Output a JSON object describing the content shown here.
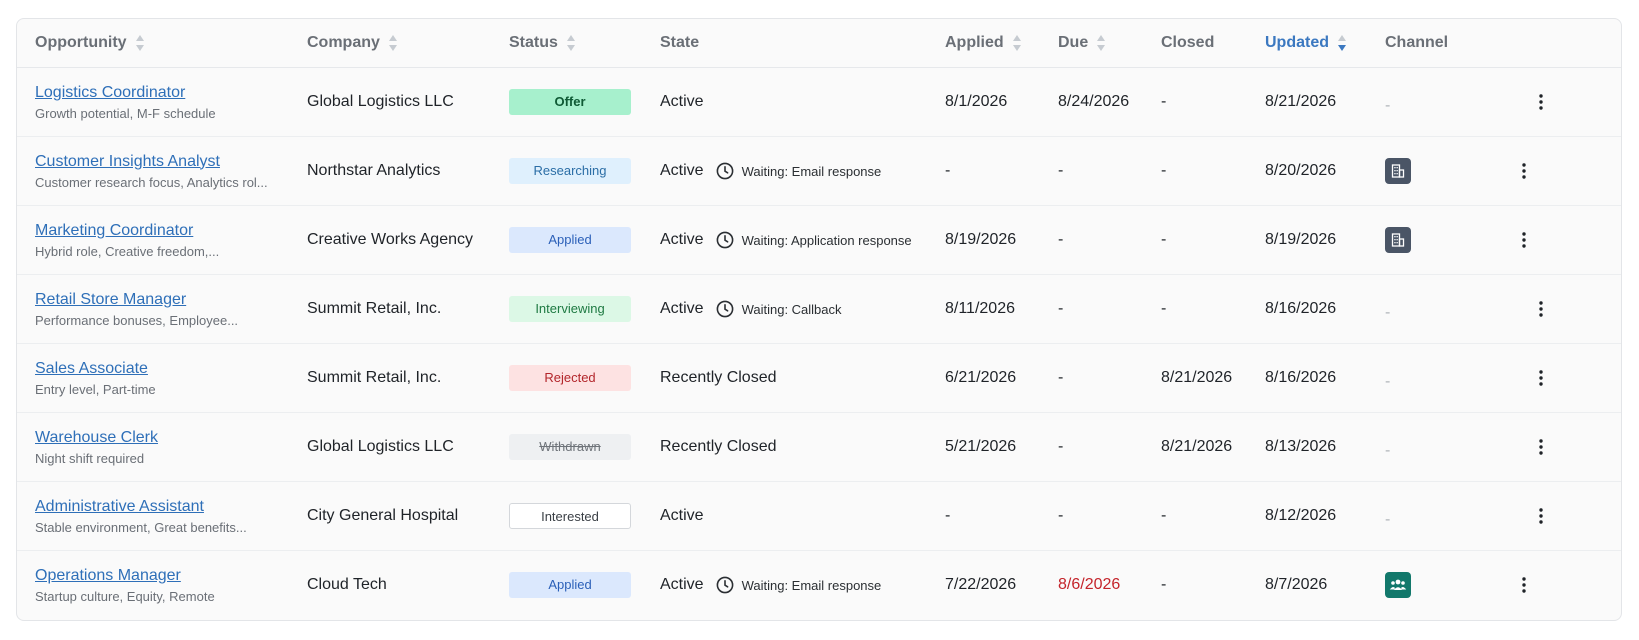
{
  "columns": {
    "opportunity": "Opportunity",
    "company": "Company",
    "status": "Status",
    "state": "State",
    "applied": "Applied",
    "due": "Due",
    "closed": "Closed",
    "updated": "Updated",
    "channel": "Channel"
  },
  "colors": {
    "link": "#2e6fb8",
    "active_sort": "#3b78c0",
    "overdue": "#c4242b"
  },
  "rows": [
    {
      "title": "Logistics Coordinator",
      "desc": "Growth potential, M-F schedule",
      "company": "Global Logistics LLC",
      "status": "Offer",
      "status_key": "offer",
      "state": "Active",
      "waiting": "",
      "applied": "8/1/2026",
      "due": "8/24/2026",
      "closed": "-",
      "updated": "8/21/2026",
      "channel": "-",
      "channel_icon": ""
    },
    {
      "title": "Customer Insights Analyst",
      "desc": "Customer research focus, Analytics rol...",
      "company": "Northstar Analytics",
      "status": "Researching",
      "status_key": "researching",
      "state": "Active",
      "waiting": "Waiting: Email response",
      "applied": "-",
      "due": "-",
      "closed": "-",
      "updated": "8/20/2026",
      "channel": "",
      "channel_icon": "building-icon"
    },
    {
      "title": "Marketing Coordinator",
      "desc": "Hybrid role, Creative freedom,...",
      "company": "Creative Works Agency",
      "status": "Applied",
      "status_key": "applied",
      "state": "Active",
      "waiting": "Waiting: Application response",
      "applied": "8/19/2026",
      "due": "-",
      "closed": "-",
      "updated": "8/19/2026",
      "channel": "",
      "channel_icon": "building-icon"
    },
    {
      "title": "Retail Store Manager",
      "desc": "Performance bonuses, Employee...",
      "company": "Summit Retail, Inc.",
      "status": "Interviewing",
      "status_key": "interviewing",
      "state": "Active",
      "waiting": "Waiting: Callback",
      "applied": "8/11/2026",
      "due": "-",
      "closed": "-",
      "updated": "8/16/2026",
      "channel": "-",
      "channel_icon": ""
    },
    {
      "title": "Sales Associate",
      "desc": "Entry level, Part-time",
      "company": "Summit Retail, Inc.",
      "status": "Rejected",
      "status_key": "rejected",
      "state": "Recently Closed",
      "waiting": "",
      "applied": "6/21/2026",
      "due": "-",
      "closed": "8/21/2026",
      "updated": "8/16/2026",
      "channel": "-",
      "channel_icon": ""
    },
    {
      "title": "Warehouse Clerk",
      "desc": "Night shift required",
      "company": "Global Logistics LLC",
      "status": "Withdrawn",
      "status_key": "withdrawn",
      "state": "Recently Closed",
      "waiting": "",
      "applied": "5/21/2026",
      "due": "-",
      "closed": "8/21/2026",
      "updated": "8/13/2026",
      "channel": "-",
      "channel_icon": ""
    },
    {
      "title": "Administrative Assistant",
      "desc": "Stable environment, Great benefits...",
      "company": "City General Hospital",
      "status": "Interested",
      "status_key": "interested",
      "state": "Active",
      "waiting": "",
      "applied": "-",
      "due": "-",
      "closed": "-",
      "updated": "8/12/2026",
      "channel": "-",
      "channel_icon": ""
    },
    {
      "title": "Operations Manager",
      "desc": "Startup culture, Equity, Remote",
      "company": "Cloud Tech",
      "status": "Applied",
      "status_key": "applied",
      "state": "Active",
      "waiting": "Waiting: Email response",
      "applied": "7/22/2026",
      "due": "8/6/2026",
      "due_overdue": true,
      "closed": "-",
      "updated": "8/7/2026",
      "channel": "",
      "channel_icon": "people-icon"
    }
  ]
}
